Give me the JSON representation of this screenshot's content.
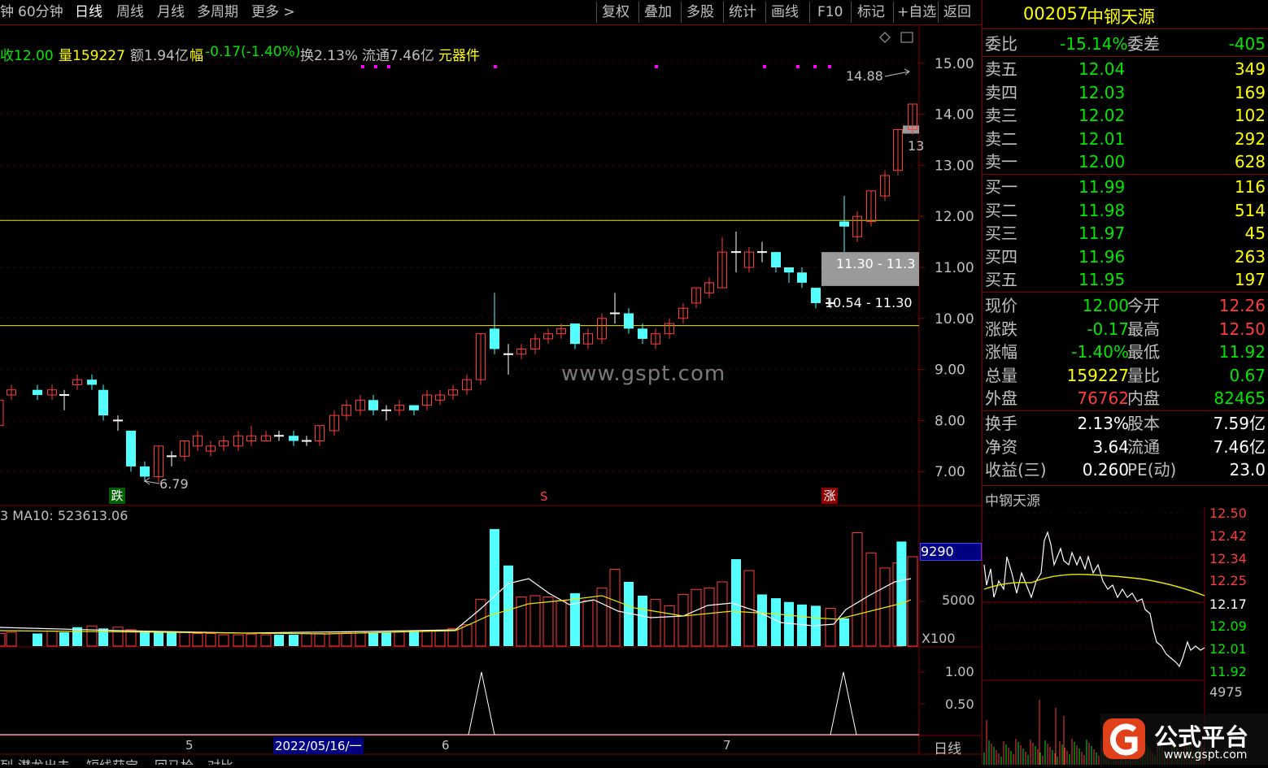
{
  "toolbar": {
    "left_items": [
      "钟",
      "60分钟",
      "日线",
      "周线",
      "月线",
      "多周期",
      "更多 >"
    ],
    "active": "日线",
    "right_items": [
      "复权",
      "叠加",
      "多股",
      "统计",
      "画线",
      "F10",
      "标记",
      "+自选",
      "返回"
    ]
  },
  "info_line": {
    "close": "收12.00",
    "volume": "量159227",
    "amount": "额1.94亿",
    "change_label": "幅",
    "change": "-0.17(-1.40%)",
    "turnover": "换2.13%",
    "float_cap": "流通7.46亿",
    "industry": "元器件"
  },
  "price_axis": [
    "15.00",
    "14.00",
    "13.00",
    "12.00",
    "11.00",
    "10.00",
    "9.00",
    "8.00",
    "7.00"
  ],
  "annotations": {
    "high": "14.88",
    "low": "6.79",
    "box_upper": "11.30 - 11.3",
    "box_lower": "10.54 - 11.30",
    "right_cut": "13",
    "marker_down": "跌",
    "marker_s": "S",
    "marker_up": "涨"
  },
  "volume_panel": {
    "title": "3  MA10: 523613.06",
    "axis_highlight": "9290",
    "axis_mid": "5000",
    "axis_unit": "X100"
  },
  "indicator_panel": {
    "axis": [
      "1.00",
      "0.50"
    ]
  },
  "date_axis": {
    "labels": [
      "5",
      "2022/05/16/一",
      "6",
      "7"
    ],
    "period": "日线"
  },
  "bottom_tabs": [
    "列",
    "潜龙出击",
    "短线获宝",
    "回马枪",
    "对比"
  ],
  "watermark": "www.gspt.com",
  "quote_panel": {
    "code": "002057",
    "name": "中钢天源",
    "weibi_label": "委比",
    "weibi": "-15.14%",
    "weicha_label": "委差",
    "weicha": "-405",
    "asks": [
      {
        "label": "卖五",
        "price": "12.04",
        "vol": "349"
      },
      {
        "label": "卖四",
        "price": "12.03",
        "vol": "169"
      },
      {
        "label": "卖三",
        "price": "12.02",
        "vol": "102"
      },
      {
        "label": "卖二",
        "price": "12.01",
        "vol": "292"
      },
      {
        "label": "卖一",
        "price": "12.00",
        "vol": "628"
      }
    ],
    "bids": [
      {
        "label": "买一",
        "price": "11.99",
        "vol": "116"
      },
      {
        "label": "买二",
        "price": "11.98",
        "vol": "514"
      },
      {
        "label": "买三",
        "price": "11.97",
        "vol": "45"
      },
      {
        "label": "买四",
        "price": "11.96",
        "vol": "263"
      },
      {
        "label": "买五",
        "price": "11.95",
        "vol": "197"
      }
    ],
    "stats": [
      {
        "l1": "现价",
        "v1": "12.00",
        "l2": "今开",
        "v2": "12.26"
      },
      {
        "l1": "涨跌",
        "v1": "-0.17",
        "l2": "最高",
        "v2": "12.50"
      },
      {
        "l1": "涨幅",
        "v1": "-1.40%",
        "l2": "最低",
        "v2": "11.92"
      },
      {
        "l1": "总量",
        "v1": "159227",
        "l2": "量比",
        "v2": "0.67"
      },
      {
        "l1": "外盘",
        "v1": "76762",
        "l2": "内盘",
        "v2": "82465"
      }
    ],
    "stats2": [
      {
        "l1": "换手",
        "v1": "2.13%",
        "l2": "股本",
        "v2": "7.59亿"
      },
      {
        "l1": "净资",
        "v1": "3.64",
        "l2": "流通",
        "v2": "7.46亿"
      },
      {
        "l1": "收益(三)",
        "v1": "0.260",
        "l2": "PE(动)",
        "v2": "23.0"
      }
    ],
    "intraday_title": "中钢天源",
    "intraday_axis": [
      "12.50",
      "12.42",
      "12.34",
      "12.25",
      "12.17",
      "12.09",
      "12.01",
      "11.92"
    ],
    "intraday_vol": "4975"
  },
  "logo": {
    "text": "公式平台",
    "url": "www.gspt.com"
  },
  "colors": {
    "up": "#ff3c3c",
    "down": "#54ffff",
    "frame": "#800000",
    "ma_yellow": "#e8e800"
  }
}
